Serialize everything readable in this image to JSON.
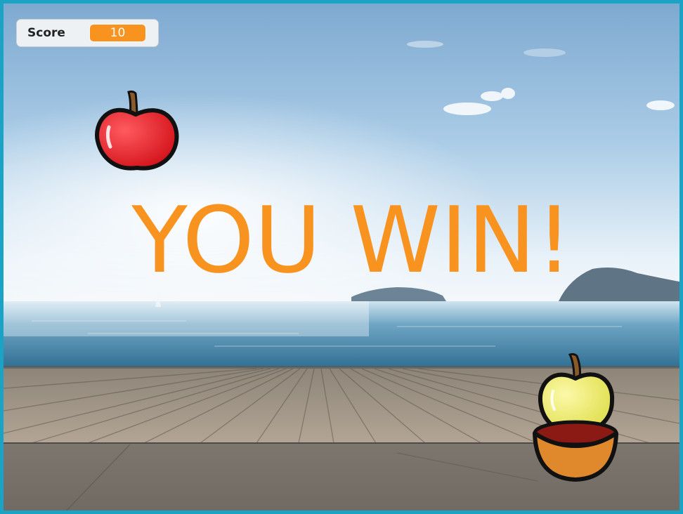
{
  "score": {
    "label": "Score",
    "value": "10"
  },
  "message": "YOU WIN!",
  "sprites": {
    "falling_apple": "red-apple",
    "caught_apple": "yellow-apple",
    "catcher": "orange-bowl"
  },
  "colors": {
    "stage_border": "#1aa3c4",
    "accent": "#f7931e"
  }
}
